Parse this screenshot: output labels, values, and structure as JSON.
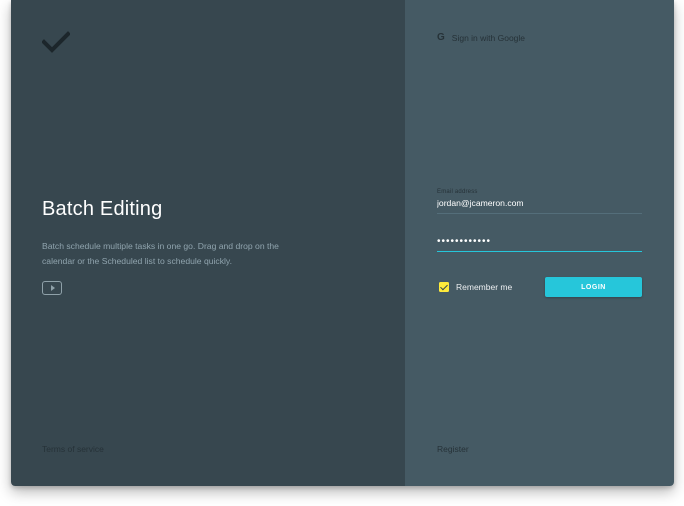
{
  "hero": {
    "title": "Batch Editing",
    "description": "Batch schedule multiple tasks in one go. Drag and drop on the calendar or the Scheduled list to schedule quickly."
  },
  "icons": {
    "logo": "checkmark-icon",
    "video": "play-icon",
    "google": "google-g-icon"
  },
  "footer": {
    "terms": "Terms of service",
    "register": "Register"
  },
  "auth": {
    "google_label": "Sign in with Google",
    "google_letter": "G",
    "email_label": "Email address",
    "email_value": "jordan@jcameron.com",
    "password_value": "••••••••••••",
    "remember_label": "Remember me",
    "remember_checked": true,
    "login_label": "LOGIN"
  },
  "colors": {
    "left_panel": "#37474f",
    "right_panel": "#455a64",
    "accent": "#26c6da",
    "checkbox": "#ffeb3b"
  }
}
